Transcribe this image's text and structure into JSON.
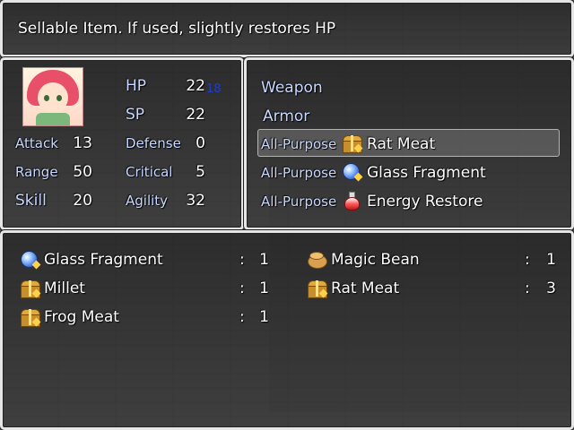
{
  "help": {
    "text": "Sellable Item. If used, slightly restores HP"
  },
  "status": {
    "hp_label": "HP",
    "hp_value": "22",
    "hp_change": "18",
    "sp_label": "SP",
    "sp_value": "22",
    "stats": [
      {
        "label": "Attack",
        "value": "13"
      },
      {
        "label": "Defense",
        "value": "0"
      },
      {
        "label": "Range",
        "value": "50"
      },
      {
        "label": "Critical",
        "value": "5"
      },
      {
        "label": "Skill",
        "value": "20"
      },
      {
        "label": "Agility",
        "value": "32"
      }
    ]
  },
  "equip": {
    "categories": [
      "Weapon",
      "Armor"
    ],
    "items": [
      {
        "slot": "All-Purpose",
        "icon": "treasure-chest-icon",
        "name": "Rat Meat"
      },
      {
        "slot": "All-Purpose",
        "icon": "blue-orb-icon",
        "name": "Glass Fragment"
      },
      {
        "slot": "All-Purpose",
        "icon": "red-potion-icon",
        "name": "Energy Restore"
      }
    ]
  },
  "inventory": {
    "separator": ":",
    "items": [
      {
        "icon": "blue-orb-icon",
        "name": "Glass Fragment",
        "qty": "1"
      },
      {
        "icon": "bean-icon",
        "name": "Magic Bean",
        "qty": "1"
      },
      {
        "icon": "treasure-chest-icon",
        "name": "Millet",
        "qty": "1"
      },
      {
        "icon": "treasure-chest-icon",
        "name": "Rat Meat",
        "qty": "3"
      },
      {
        "icon": "treasure-chest-icon",
        "name": "Frog Meat",
        "qty": "1"
      }
    ]
  },
  "colors": {
    "label_blue": "#c9d8ff",
    "hp_change_blue": "#1e3ec8",
    "window_border": "#e6e6e6"
  }
}
